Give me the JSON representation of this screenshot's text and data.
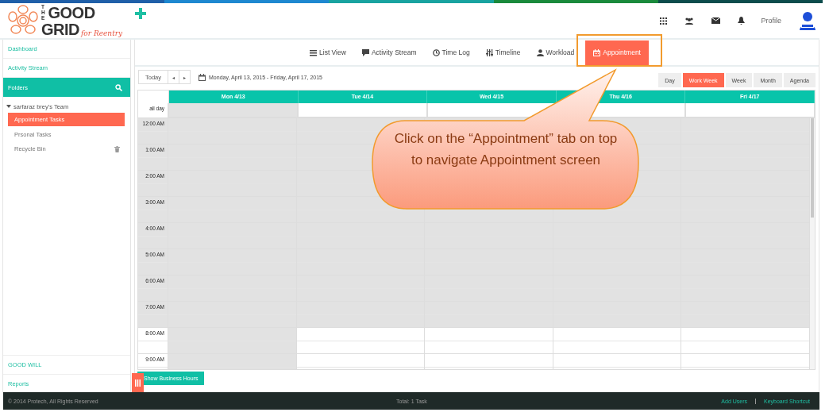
{
  "header": {
    "logo": {
      "the": "THE",
      "line1": "GOOD",
      "line2": "GRID",
      "tagline": "for Reentry"
    },
    "profile": "Profile"
  },
  "sidebar": {
    "top_items": [
      "Dashboard",
      "Activity Stream"
    ],
    "folders": {
      "label": "Folders"
    },
    "team": {
      "name": "sarfaraz brey's Team",
      "expanded": true,
      "children": [
        {
          "label": "Appointment Tasks",
          "selected": true,
          "kind": "task"
        },
        {
          "label": "Prsonal Tasks",
          "selected": false,
          "kind": "task"
        },
        {
          "label": "Recycle Bin",
          "selected": false,
          "kind": "bin"
        }
      ]
    },
    "bottom_items": [
      "GOOD WILL",
      "Reports"
    ]
  },
  "tabs": [
    {
      "label": "List View",
      "kind": "list",
      "selected": false
    },
    {
      "label": "Activity Stream",
      "kind": "comment",
      "selected": false
    },
    {
      "label": "Time Log",
      "kind": "clock",
      "selected": false
    },
    {
      "label": "Timeline",
      "kind": "sliders",
      "selected": false
    },
    {
      "label": "Workload",
      "kind": "user",
      "selected": false
    },
    {
      "label": "Appointment",
      "kind": "calendar",
      "selected": true
    }
  ],
  "toolbar": {
    "today": "Today",
    "prev": "◂",
    "next": "▸",
    "range": "Monday, April 13, 2015 - Friday, April 17, 2015",
    "views": [
      {
        "label": "Day",
        "selected": false
      },
      {
        "label": "Work Week",
        "selected": true
      },
      {
        "label": "Week",
        "selected": false
      },
      {
        "label": "Month",
        "selected": false
      },
      {
        "label": "Agenda",
        "selected": false
      }
    ]
  },
  "calendar": {
    "all_day": "all day",
    "days": [
      {
        "label": "Mon 4/13",
        "today": true
      },
      {
        "label": "Tue 4/14",
        "today": false
      },
      {
        "label": "Wed 4/15",
        "today": false
      },
      {
        "label": "Thu 4/16",
        "today": false
      },
      {
        "label": "Fri 4/17",
        "today": false
      }
    ],
    "hours": [
      {
        "label": "12:00 AM",
        "business": false
      },
      {
        "label": "1:00 AM",
        "business": false
      },
      {
        "label": "2:00 AM",
        "business": false
      },
      {
        "label": "3:00 AM",
        "business": false
      },
      {
        "label": "4:00 AM",
        "business": false
      },
      {
        "label": "5:00 AM",
        "business": false
      },
      {
        "label": "6:00 AM",
        "business": false
      },
      {
        "label": "7:00 AM",
        "business": false
      },
      {
        "label": "8:00 AM",
        "business": true
      },
      {
        "label": "9:00 AM",
        "business": true
      }
    ],
    "business_button": "Show Business Hours"
  },
  "callout": {
    "text": "Click on the “Appointment” tab on top to navigate Appointment screen"
  },
  "footer": {
    "copyright": "© 2014 Protech, All Rights Reserved",
    "total": "Total: 1 Task",
    "links": [
      "Add Users",
      "Keyboard Shortcut"
    ]
  }
}
